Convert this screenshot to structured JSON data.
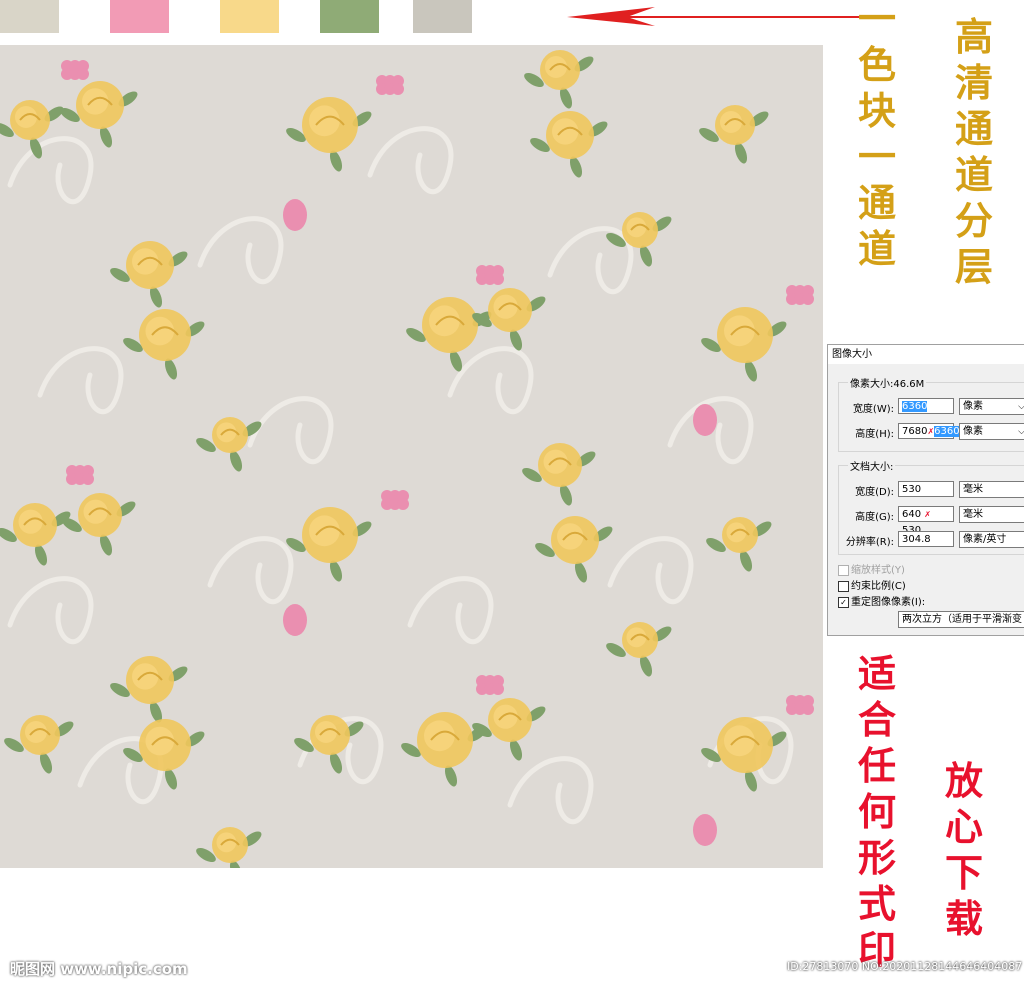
{
  "swatches": [
    {
      "color": "#d9d5c8"
    },
    {
      "color": "#f29bb5"
    },
    {
      "color": "#f8d98a"
    },
    {
      "color": "#8fab76"
    },
    {
      "color": "#c9c6bd"
    }
  ],
  "colors": {
    "arrow": "#e02020",
    "gold_text": "#d4a017",
    "red_text": "#e8112d",
    "pattern_bg": "#dedad5",
    "rose_yellow": "#f0c65c",
    "rose_pink": "#ea8fb0",
    "leaf": "#7fa06a",
    "swirl": "#eeebe6"
  },
  "left_vertical_text": [
    "一",
    "色",
    "块",
    "一",
    "通",
    "道"
  ],
  "right_vertical_text": [
    "高",
    "清",
    "通",
    "道",
    "分",
    "层"
  ],
  "print_vertical_text": [
    "适",
    "合",
    "任",
    "何",
    "形",
    "式",
    "印"
  ],
  "download_vertical_text": [
    "放",
    "心",
    "下",
    "载"
  ],
  "dialog": {
    "title": "图像大小",
    "pixel_size_label": "像素大小:46.6M",
    "width_label": "宽度(W):",
    "width_value": "6360",
    "width_unit": "像素",
    "height_label": "高度(H):",
    "height_value_old": "7680",
    "height_value_new": "6360",
    "height_unit": "像素",
    "doc_size_label": "文档大小:",
    "doc_width_label": "宽度(D):",
    "doc_width_value": "530",
    "doc_width_unit": "毫米",
    "doc_height_label": "高度(G):",
    "doc_height_value_old": "640",
    "doc_height_value_new": "530",
    "doc_height_unit": "毫米",
    "resolution_label": "分辨率(R):",
    "resolution_value": "304.8",
    "resolution_unit": "像素/英寸",
    "scale_styles_label": "缩放样式(Y)",
    "constrain_label": "约束比例(C)",
    "resample_label": "重定图像像素(I):",
    "resample_method": "两次立方（适用于平滑渐变"
  },
  "footer": {
    "logo": "昵图网 www.nipic.com",
    "id_text": "ID:27813070 NO:20201128144646404087"
  }
}
